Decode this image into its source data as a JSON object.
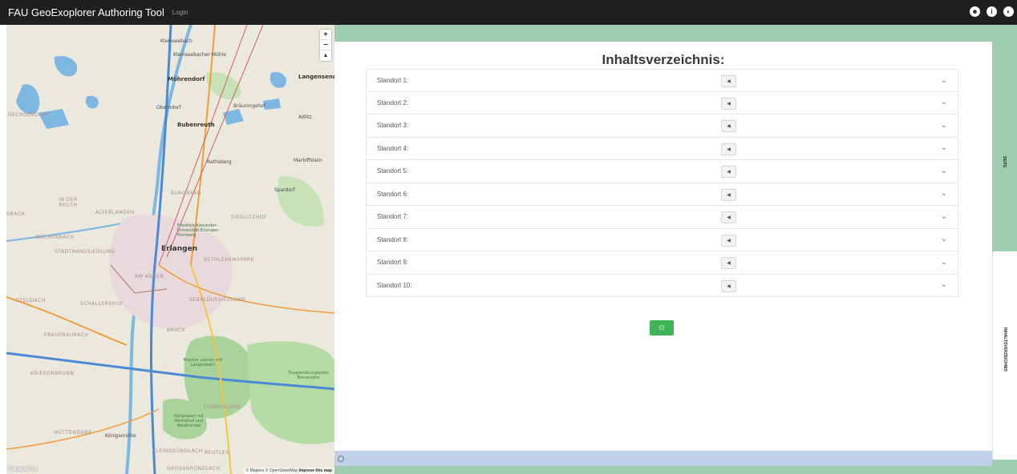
{
  "topbar": {
    "app_title": "FAU GeoExoplorer Authoring Tool",
    "login_label": "Login",
    "icons": [
      "user-icon",
      "info-icon",
      "logout-icon"
    ]
  },
  "map": {
    "zoom_in": "+",
    "zoom_out": "−",
    "compass": "▲",
    "logo": "©mapbox",
    "attribution_prefix": "© Mapbox © OpenStreetMap",
    "attribution_link": "Improve this map",
    "labels": {
      "kleinseebach": "Kleinseebach",
      "kleinseebacher_muehle": "Kleinseebacher Mühle",
      "moehrendorf": "Möhrendorf",
      "langensendelbach": "Langensende",
      "oberndorf": "Oberndorf",
      "braeuningshof": "Bräuningshof",
      "adlitz": "Adlitz",
      "dechsendorf": "DECHSENDORF",
      "bubenreuth": "Bubenreuth",
      "rathsberg": "Rathsberg",
      "marloffstein": "Marloffstein",
      "spardorf": "Spardorf",
      "in_der_reuth": "IN DER REUTH",
      "alterlangen": "ALTERLANGEN",
      "burgberg": "BURGBERG",
      "sieglitzhof": "SIEGLITZHOF",
      "bach": "SBACH",
      "buechenbach": "BÜCHENBACH",
      "fau": "Friedrich-Alexander-Universität Erlangen-Nürnberg",
      "stadtrandsiedlung": "STADTRANDSIEDLUNG",
      "erlangen": "Erlangen",
      "bethlehemspark": "BETHLEHEMSPARK",
      "am_anger": "AM ANGER",
      "steudach": "STEUDACH",
      "schallershof": "SCHALLERSHOF",
      "sebaldussiedlung": "SEBALDUSSIEDLUNG",
      "frauenaurach": "FRAUENAURACH",
      "bruck": "BRUCK",
      "brucker_lache": "Brucker Lachen mit Langenwehr",
      "kriegenbrunn": "KRIEGENBRUNN",
      "tennenlohe": "TENNENLOHE",
      "truppenuebungsplatz": "Truppenübungsplatz Tennenlohe",
      "huettendorf": "HÜTTENDORF",
      "koenigsmuehle": "Königsmühle",
      "heilgraben": "Heilgraben mit Winkelhuf und Waldhorstel",
      "kleingruendlach": "KLEINGRÜNDLACH",
      "reutles": "REUTLES",
      "grossgruendlach": "GROSSGRÜNDLACH"
    }
  },
  "content": {
    "heading": "Inhaltsverzeichnis:",
    "rows": [
      {
        "label": "Standort 1:",
        "button": "◀"
      },
      {
        "label": "Standort 2:",
        "button": "◀"
      },
      {
        "label": "Standort 3:",
        "button": "◀"
      },
      {
        "label": "Standort 4:",
        "button": "◀"
      },
      {
        "label": "Standort 5:",
        "button": "◀"
      },
      {
        "label": "Standort 6:",
        "button": "◀"
      },
      {
        "label": "Standort 7:",
        "button": "◀"
      },
      {
        "label": "Standort 8:",
        "button": "◀"
      },
      {
        "label": "Standort 9:",
        "button": "◀"
      },
      {
        "label": "Standort 10:",
        "button": "◀"
      }
    ],
    "chevron": "⌄",
    "save_button": "⏻"
  },
  "side_tabs": {
    "seite": "SEITE",
    "inhaltsverzeichnis": "INHALTSVERZEICHNIS"
  },
  "colors": {
    "topbar": "#1f1f1f",
    "panel_green": "#9fcdb0",
    "bottom_bar": "#c1d1ea",
    "save_green": "#3fb457"
  }
}
